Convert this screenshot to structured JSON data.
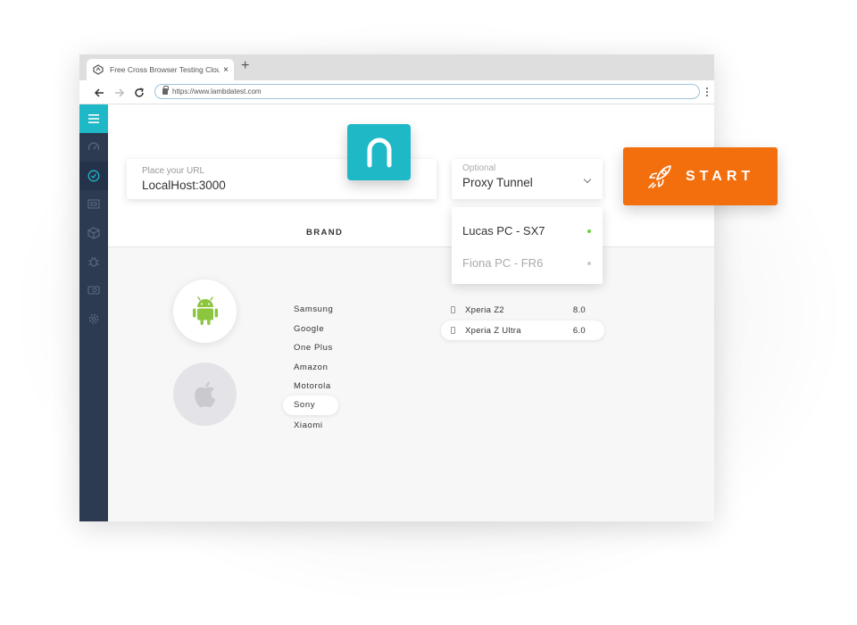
{
  "browser": {
    "tab_title": "Free Cross Browser Testing Clou",
    "tab_close": "×",
    "new_tab": "+",
    "url": "https://www.lambdatest.com"
  },
  "url_input": {
    "placeholder": "Place your URL",
    "value": "LocalHost:3000"
  },
  "proxy": {
    "placeholder": "Optional",
    "value": "Proxy Tunnel",
    "options": [
      {
        "label": "Lucas PC - SX7",
        "status_color": "#6bd13b"
      },
      {
        "label": "Fiona PC - FR6",
        "status_color": "#c8c8c8"
      }
    ]
  },
  "start_button": {
    "label": "START",
    "color": "#f36e0c"
  },
  "brand_heading": "BRAND",
  "os": [
    {
      "icon": "android-icon",
      "color": "#8cc63f"
    },
    {
      "icon": "apple-icon",
      "color": "#c9c9cf"
    }
  ],
  "brands": [
    "Samsung",
    "Google",
    "One Plus",
    "Amazon",
    "Motorola",
    "Sony",
    "Xiaomi"
  ],
  "selected_brand": "Sony",
  "devices": [
    {
      "name": "Xperia Z2",
      "version": "8.0"
    },
    {
      "name": "Xperia Z Ultra",
      "version": "6.0"
    }
  ],
  "selected_device": "Xperia Z Ultra",
  "colors": {
    "accent": "#1fb8c7",
    "sidebar": "#2d3b51"
  }
}
